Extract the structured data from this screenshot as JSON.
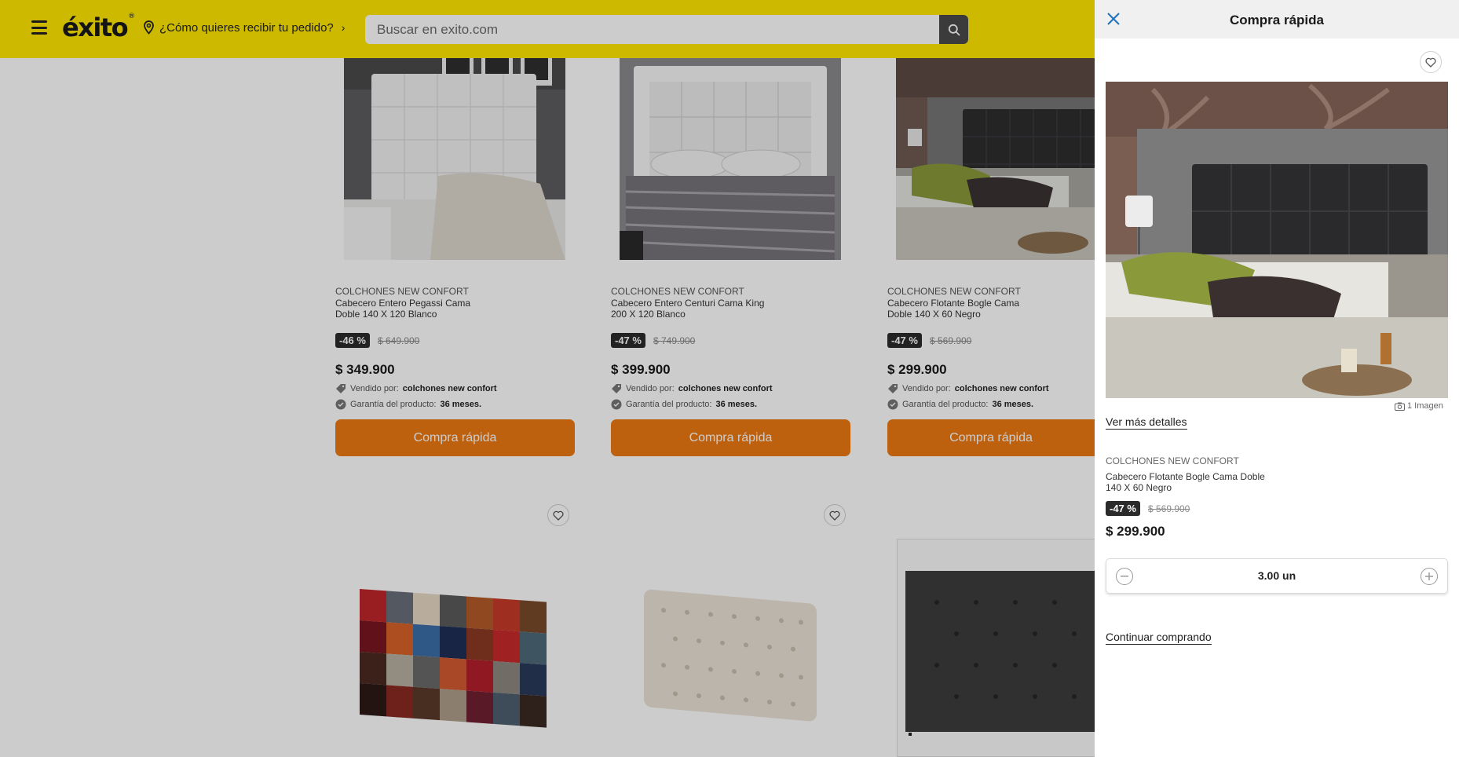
{
  "header": {
    "logo": "éxito",
    "delivery_text": "¿Cómo quieres recibir tu pedido?",
    "search_placeholder": "Buscar en exito.com"
  },
  "products": [
    {
      "brand": "COLCHONES NEW CONFORT",
      "name": "Cabecero Entero Pegassi Cama Doble 140 X 120 Blanco",
      "discount": "-46 %",
      "old_price": "$ 649.900",
      "price": "$ 349.900",
      "seller_label": "Vendido por:",
      "seller": "colchones new confort",
      "warranty_label": "Garantía del producto:",
      "warranty": "36 meses.",
      "button": "Compra rápida"
    },
    {
      "brand": "COLCHONES NEW CONFORT",
      "name": "Cabecero Entero Centuri Cama King 200 X 120 Blanco",
      "discount": "-47 %",
      "old_price": "$ 749.900",
      "price": "$ 399.900",
      "seller_label": "Vendido por:",
      "seller": "colchones new confort",
      "warranty_label": "Garantía del producto:",
      "warranty": "36 meses.",
      "button": "Compra rápida"
    },
    {
      "brand": "COLCHONES NEW CONFORT",
      "name": "Cabecero Flotante Bogle Cama Doble 140 X 60 Negro",
      "discount": "-47 %",
      "old_price": "$ 569.900",
      "price": "$ 299.900",
      "seller_label": "Vendido por:",
      "seller": "colchones new confort",
      "warranty_label": "Garantía del producto:",
      "warranty": "36 meses.",
      "button": "Compra rápida"
    }
  ],
  "drawer": {
    "title": "Compra rápida",
    "image_count": "1 Imagen",
    "more_details": "Ver más detalles",
    "brand": "COLCHONES NEW CONFORT",
    "name": "Cabecero Flotante Bogle Cama Doble 140 X 60 Negro",
    "discount": "-47 %",
    "old_price": "$ 569.900",
    "price": "$ 299.900",
    "quantity": "3.00 un",
    "continue": "Continuar comprando"
  },
  "colors": {
    "header_bg": "#ffe800",
    "button_orange": "#ee7a13",
    "badge_dark": "#2b2b2b"
  },
  "icons": [
    "menu-icon",
    "location-pin-icon",
    "chevron-right-icon",
    "search-icon",
    "heart-icon",
    "close-icon",
    "camera-icon",
    "minus-icon",
    "plus-icon",
    "tag-icon",
    "shield-check-icon"
  ]
}
